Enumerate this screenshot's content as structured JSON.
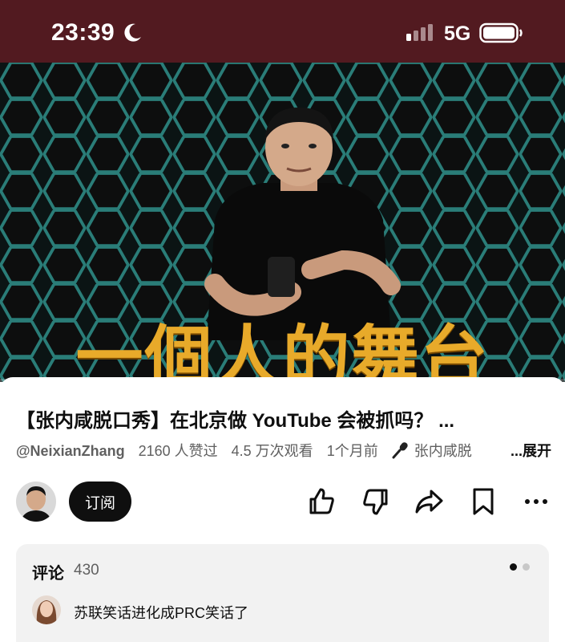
{
  "status_bar": {
    "time": "23:39",
    "network": "5G"
  },
  "video": {
    "thumbnail_caption": "一個人的舞台",
    "progress": 0.0,
    "colors": {
      "caption": "#e8aa2a",
      "hex_grid": "#2f8f8a",
      "progress": "#ff0000"
    }
  },
  "details": {
    "title": "【张内咸脱口秀】在北京做 YouTube 会被抓吗？ ...",
    "channel_handle": "@NeixianZhang",
    "likes": "2160 人赞过",
    "views": "4.5 万次观看",
    "published": "1个月前",
    "audio_label": "张内咸脱",
    "expand_label": "...展开"
  },
  "actions": {
    "subscribe_label": "订阅",
    "icons": [
      "like-icon",
      "dislike-icon",
      "share-icon",
      "save-icon",
      "more-icon"
    ]
  },
  "comments": {
    "header": "评论",
    "count": "430",
    "top_comment": "苏联笑话进化成PRC笑话了"
  }
}
